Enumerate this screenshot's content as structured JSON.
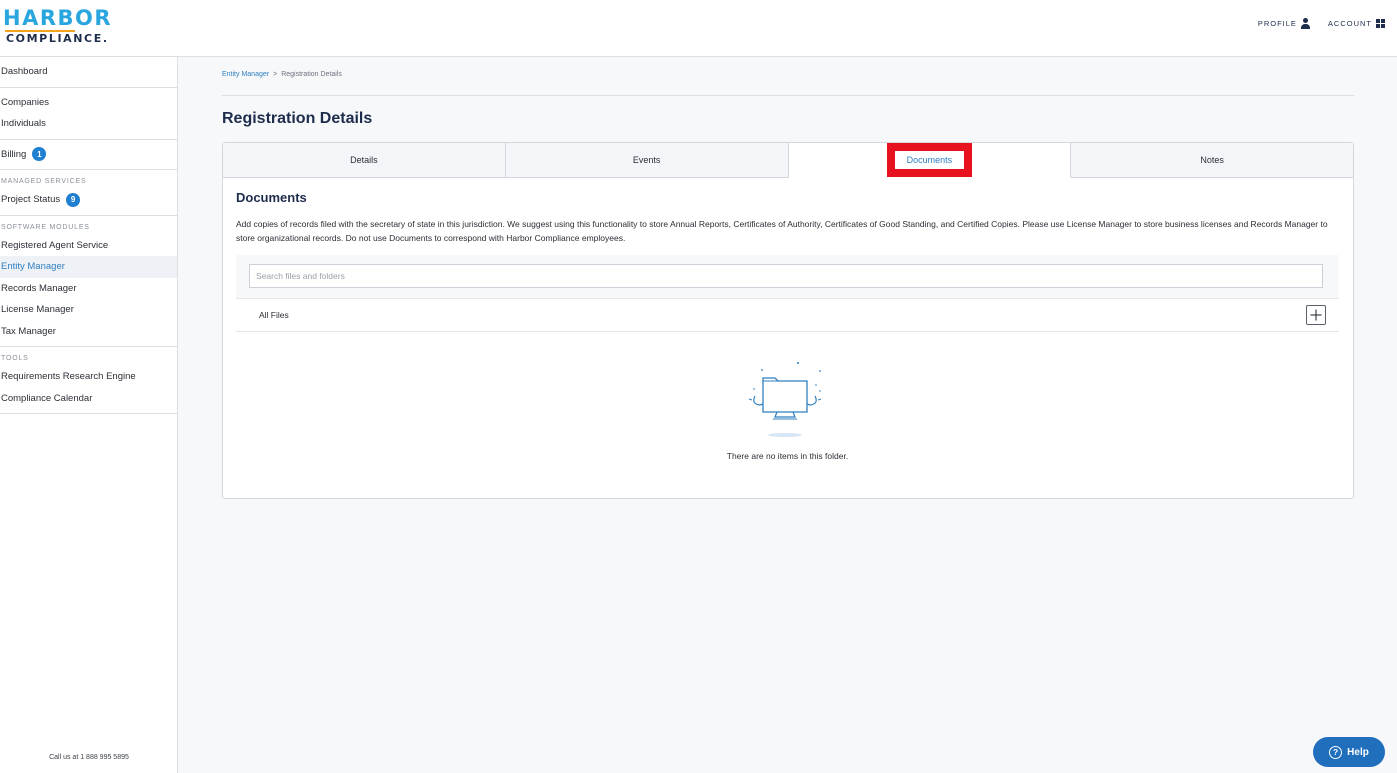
{
  "brand": {
    "line1": "HARBOR",
    "line2": "COMPLIANCE."
  },
  "header": {
    "profile_label": "PROFILE",
    "profile_icon": "person-icon",
    "account_label": "ACCOUNT",
    "account_icon": "grid-icon"
  },
  "sidebar": {
    "dashboard": "Dashboard",
    "companies": "Companies",
    "individuals": "Individuals",
    "billing": "Billing",
    "billing_badge": "1",
    "managed_heading": "MANAGED SERVICES",
    "project_status": "Project Status",
    "project_badge": "9",
    "software_heading": "SOFTWARE MODULES",
    "registered_agent": "Registered Agent Service",
    "entity_manager": "Entity Manager",
    "records_manager": "Records Manager",
    "license_manager": "License Manager",
    "tax_manager": "Tax Manager",
    "tools_heading": "TOOLS",
    "research_engine": "Requirements Research Engine",
    "compliance_calendar": "Compliance Calendar",
    "call_us": "Call us at 1 888 995 5895"
  },
  "breadcrumb": {
    "parent": "Entity Manager",
    "separator": ">",
    "current": "Registration Details"
  },
  "page": {
    "title": "Registration Details"
  },
  "tabs": {
    "details": "Details",
    "events": "Events",
    "documents": "Documents",
    "notes": "Notes",
    "active": "Documents"
  },
  "documents": {
    "title": "Documents",
    "description": "Add copies of records filed with the secretary of state in this jurisdiction. We suggest using this functionality to store Annual Reports, Certificates of Authority, Certificates of Good Standing, and Certified Copies. Please use License Manager to store business licenses and Records Manager to store organizational records. Do not use Documents to correspond with Harbor Compliance employees.",
    "search_placeholder": "Search files and folders",
    "search_value": "",
    "all_files": "All Files",
    "empty_message": "There are no items in this folder."
  },
  "help": {
    "label": "Help"
  },
  "colors": {
    "accent": "#2f7fc1",
    "highlight": "#e8121e",
    "navy": "#1f2d4d",
    "badge": "#1f7fd0"
  }
}
